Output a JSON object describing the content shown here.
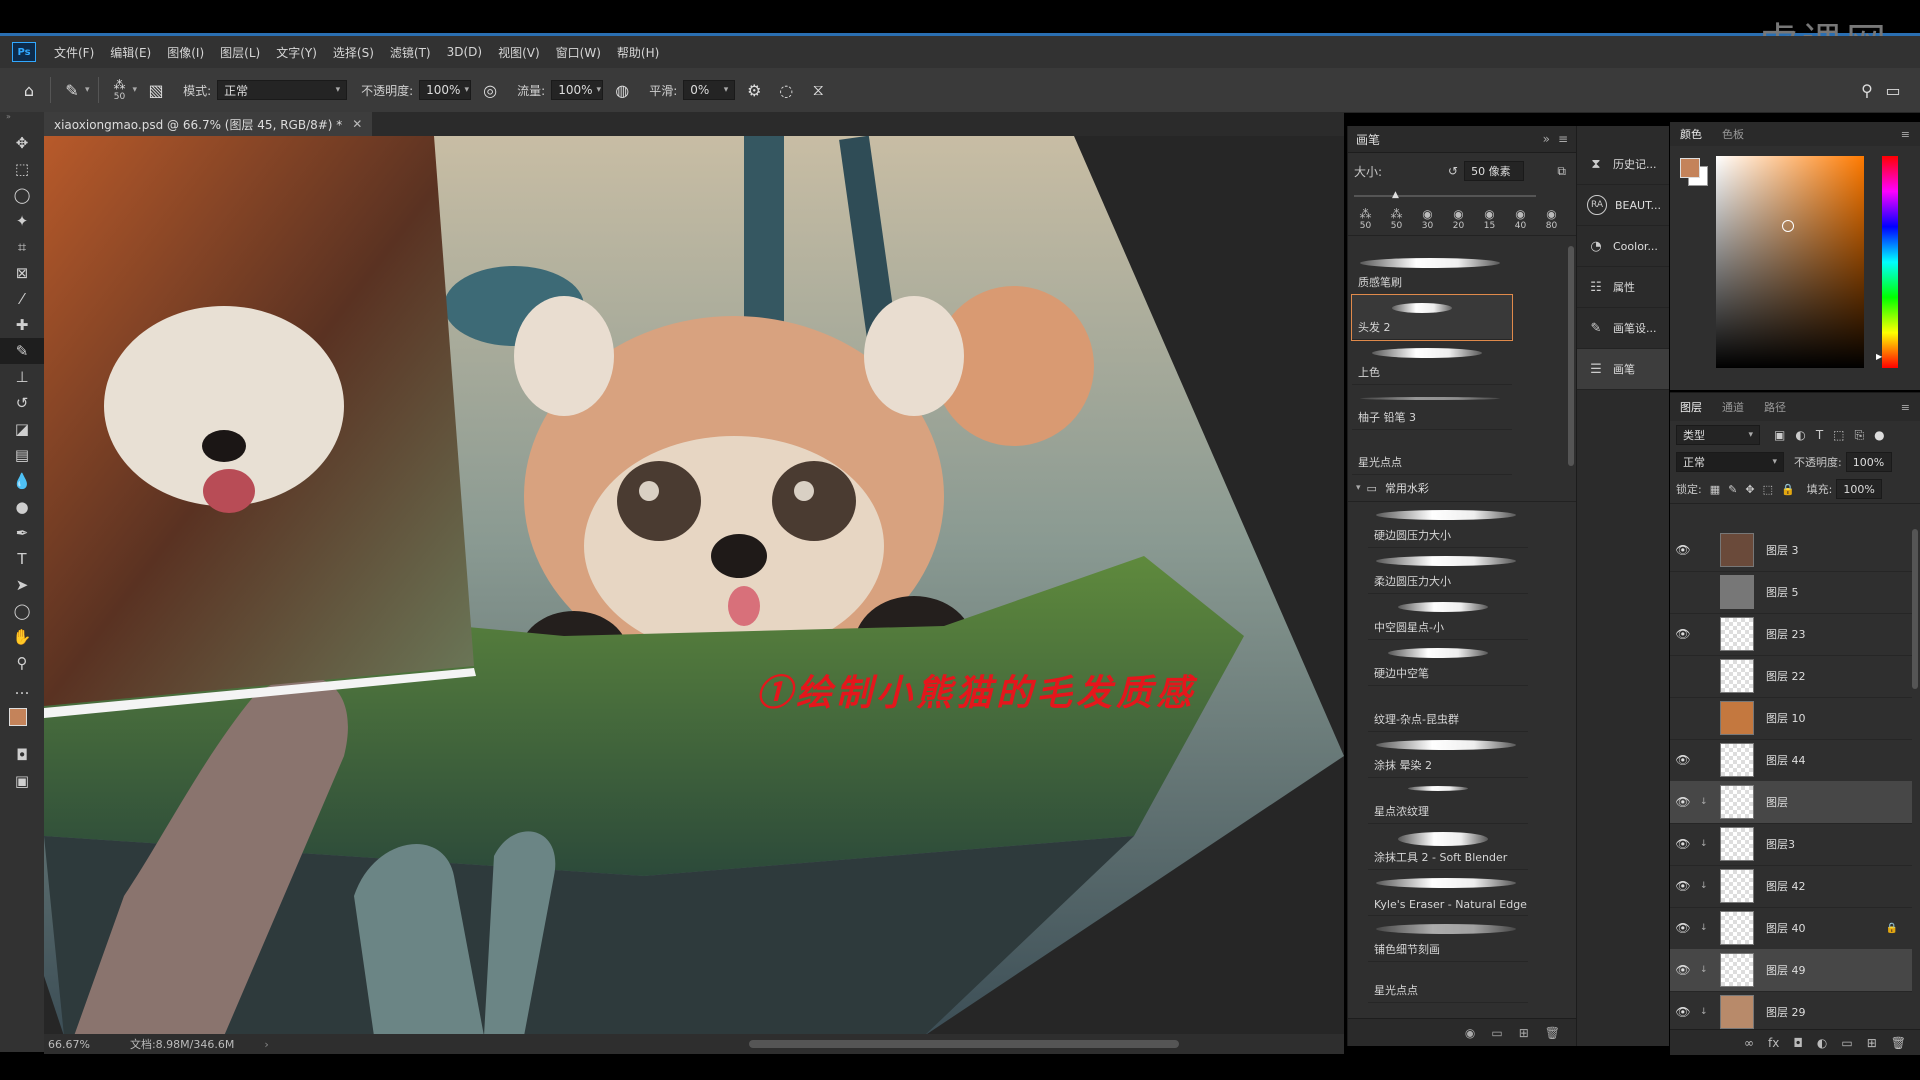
{
  "app": {
    "logo": "Ps",
    "watermark": "虎课网"
  },
  "menu": [
    "文件(F)",
    "编辑(E)",
    "图像(I)",
    "图层(L)",
    "文字(Y)",
    "选择(S)",
    "滤镜(T)",
    "3D(D)",
    "视图(V)",
    "窗口(W)",
    "帮助(H)"
  ],
  "options": {
    "brush_size": "50",
    "mode_label": "模式:",
    "mode_value": "正常",
    "opacity_label": "不透明度:",
    "opacity_value": "100%",
    "flow_label": "流量:",
    "flow_value": "100%",
    "smooth_label": "平滑:",
    "smooth_value": "0%"
  },
  "document": {
    "tab_title": "xiaoxiongmao.psd @ 66.7% (图层 45, RGB/8#) *",
    "annotation": "①绘制小熊猫的毛发质感",
    "zoom": "66.67%",
    "doc_size": "文档:8.98M/346.6M"
  },
  "brush_panel": {
    "title": "画笔",
    "size_label": "大小:",
    "size_value": "50 像素",
    "presets": [
      "50",
      "50",
      "30",
      "20",
      "15",
      "40",
      "80"
    ],
    "brushes": [
      "质感笔刷",
      "头发 2",
      "上色",
      "柚子 铅笔 3",
      "星光点点"
    ],
    "group_name": "常用水彩",
    "group_brushes": [
      "硬边圆压力大小",
      "柔边圆压力大小",
      "中空圆星点-小",
      "硬边中空笔",
      "纹理-杂点-昆虫群",
      "涂抹 晕染 2",
      "星点浓纹理",
      "涂抹工具 2 - Soft Blender",
      "Kyle's Eraser - Natural Edge",
      "铺色细节刻画",
      "星光点点"
    ]
  },
  "mini_panels": [
    "历史记...",
    "BEAUT...",
    "Coolor...",
    "属性",
    "画笔设...",
    "画笔"
  ],
  "color_panel": {
    "tabs": [
      "颜色",
      "色板"
    ],
    "foreground": "#c4835a",
    "background": "#ffffff"
  },
  "layers_panel": {
    "tabs": [
      "图层",
      "通道",
      "路径"
    ],
    "filter_kind": "类型",
    "blend_mode": "正常",
    "opacity_label": "不透明度:",
    "opacity_value": "100%",
    "lock_label": "锁定:",
    "fill_label": "填充:",
    "fill_value": "100%",
    "layers": [
      {
        "name": "图层 3",
        "visible": true,
        "clip": false
      },
      {
        "name": "图层 5",
        "visible": false,
        "clip": false
      },
      {
        "name": "图层 23",
        "visible": true,
        "clip": false
      },
      {
        "name": "图层 22",
        "visible": false,
        "clip": false
      },
      {
        "name": "图层 10",
        "visible": false,
        "clip": false
      },
      {
        "name": "图层 44",
        "visible": true,
        "clip": false
      },
      {
        "name": "图层",
        "visible": true,
        "clip": true
      },
      {
        "name": "图层3",
        "visible": true,
        "clip": true
      },
      {
        "name": "图层 42",
        "visible": true,
        "clip": true
      },
      {
        "name": "图层 40",
        "visible": true,
        "clip": true
      },
      {
        "name": "图层 49",
        "visible": true,
        "clip": true
      },
      {
        "name": "图层 29",
        "visible": true,
        "clip": true
      }
    ]
  }
}
